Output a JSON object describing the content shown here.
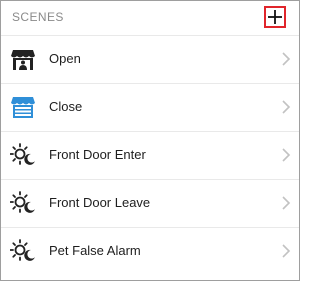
{
  "header": {
    "title": "SCENES",
    "add_icon": "plus-icon",
    "add_highlight_color": "#e0252b"
  },
  "scenes": [
    {
      "label": "Open",
      "icon": "storefront-open-icon"
    },
    {
      "label": "Close",
      "icon": "storefront-closed-icon"
    },
    {
      "label": "Front Door Enter",
      "icon": "sun-moon-icon"
    },
    {
      "label": "Front Door Leave",
      "icon": "sun-moon-icon"
    },
    {
      "label": "Pet False Alarm",
      "icon": "sun-moon-icon"
    }
  ],
  "colors": {
    "text": "#1e1e1e",
    "muted": "#8a8a8a",
    "icon_dark": "#222222",
    "icon_blue": "#2f8fd8",
    "chevron": "#c2c2c2"
  }
}
